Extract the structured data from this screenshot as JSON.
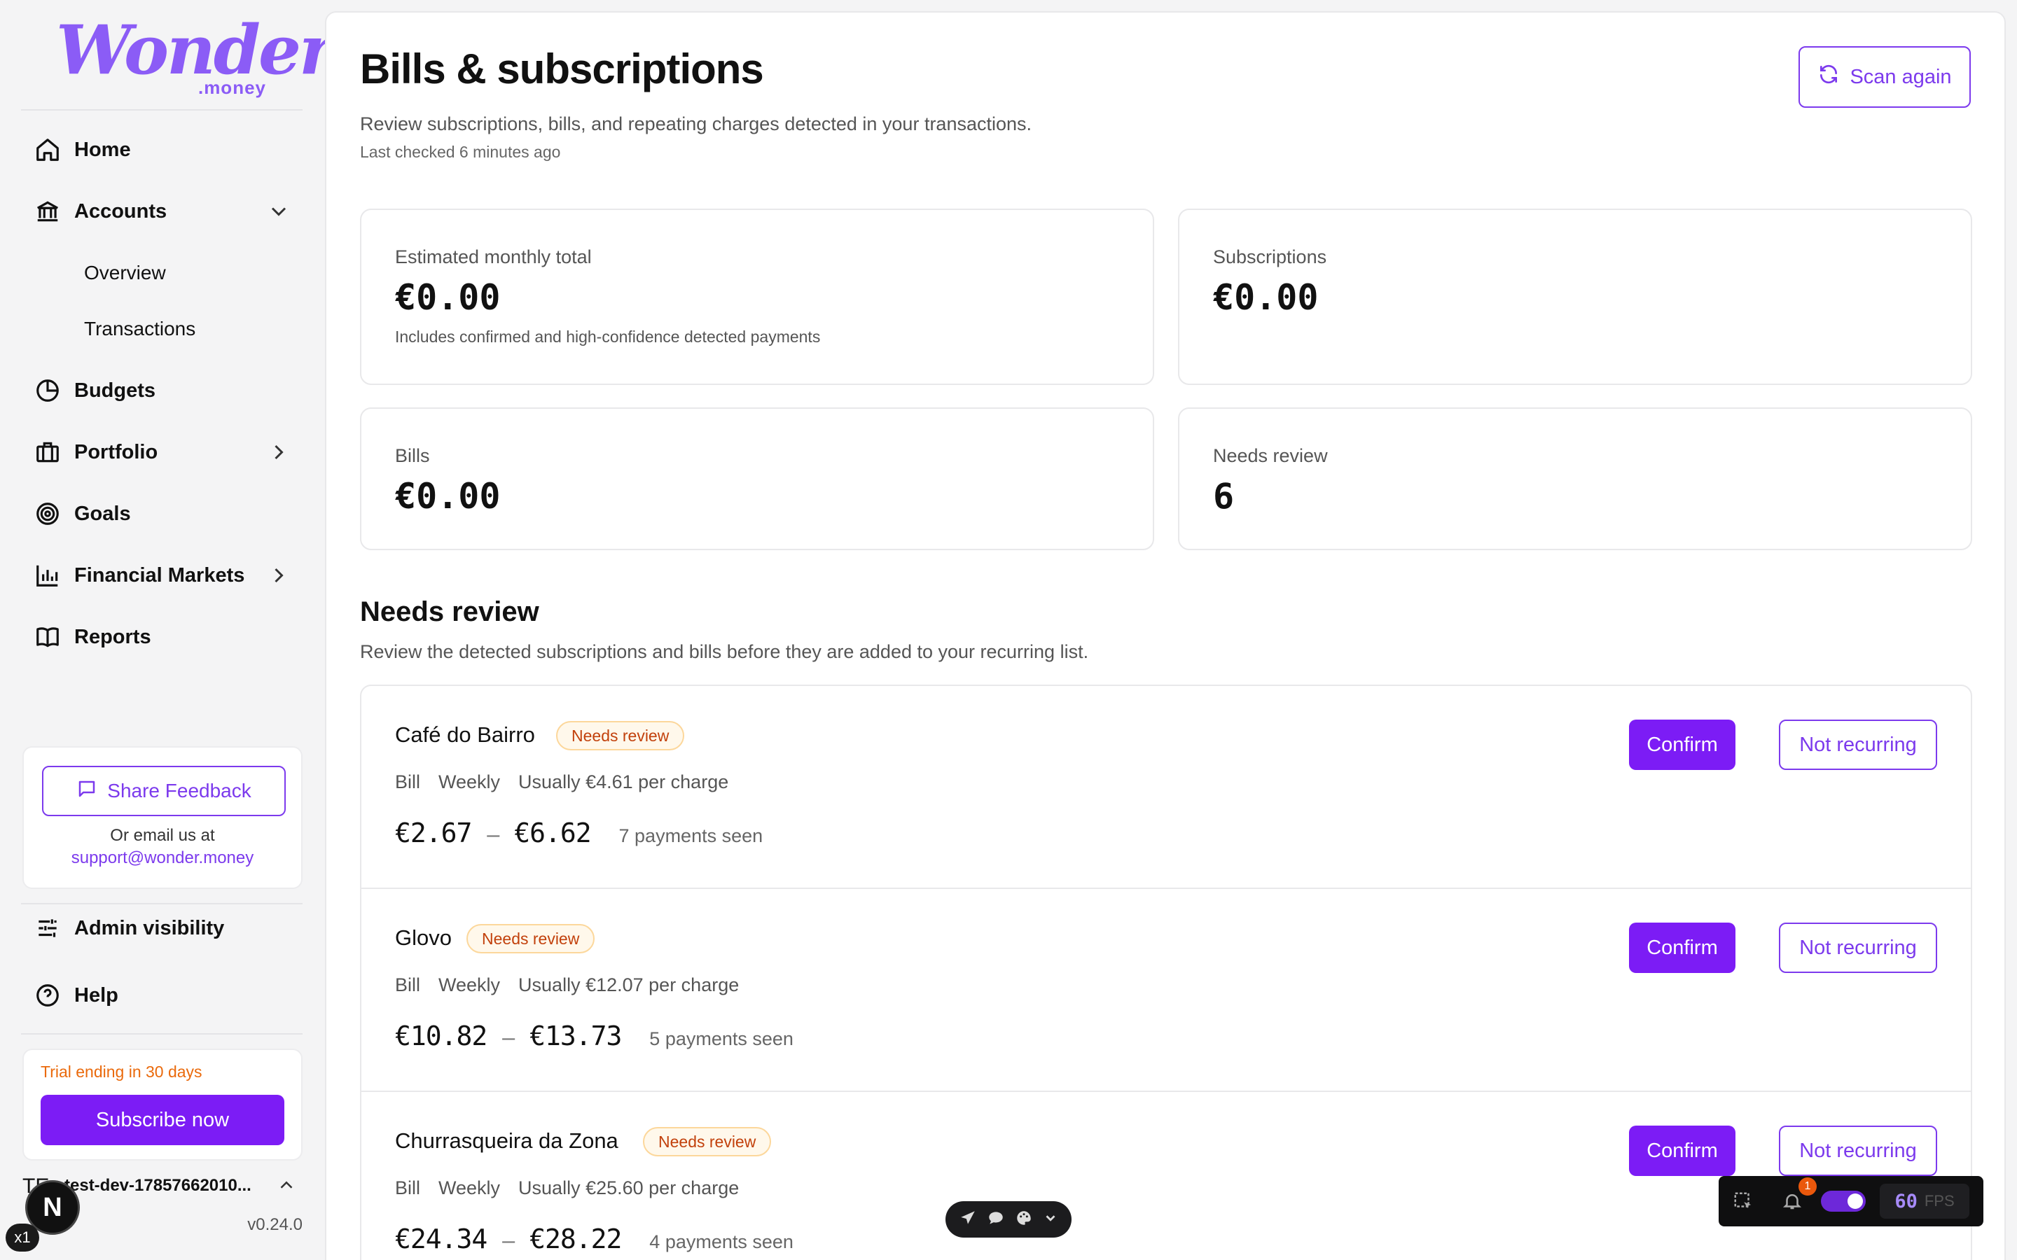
{
  "brand": {
    "name": "Wonder",
    "tld": ".money",
    "color": "#8b5cf6"
  },
  "sidebar": {
    "items": [
      {
        "label": "Home",
        "icon": "home-icon"
      },
      {
        "label": "Accounts",
        "icon": "bank-icon",
        "expanded": true
      },
      {
        "label": "Overview"
      },
      {
        "label": "Transactions"
      },
      {
        "label": "Budgets",
        "icon": "pie-chart-icon"
      },
      {
        "label": "Portfolio",
        "icon": "briefcase-icon"
      },
      {
        "label": "Goals",
        "icon": "target-icon"
      },
      {
        "label": "Financial Markets",
        "icon": "bar-chart-icon"
      },
      {
        "label": "Reports",
        "icon": "book-icon"
      }
    ],
    "feedback": {
      "button_label": "Share Feedback",
      "or_text": "Or email us at",
      "email": "support@wonder.money"
    },
    "admin_label": "Admin visibility",
    "help_label": "Help",
    "trial": {
      "text": "Trial ending in 30 days",
      "button_label": "Subscribe now"
    },
    "user": {
      "initials": "TE",
      "name": "test-dev-17857662010..."
    },
    "version": "v0.24.0"
  },
  "page": {
    "title": "Bills & subscriptions",
    "subtitle": "Review subscriptions, bills, and repeating charges detected in your transactions.",
    "last_checked": "Last checked 6 minutes ago",
    "scan_button": "Scan again"
  },
  "stats": {
    "monthly": {
      "label": "Estimated monthly total",
      "value": "€0.00",
      "note": "Includes confirmed and high-confidence detected payments"
    },
    "subscriptions": {
      "label": "Subscriptions",
      "value": "€0.00"
    },
    "bills": {
      "label": "Bills",
      "value": "€0.00"
    },
    "needs_review": {
      "label": "Needs review",
      "value": "6"
    }
  },
  "needs_review": {
    "title": "Needs review",
    "subtitle": "Review the detected subscriptions and bills before they are added to your recurring list.",
    "confirm_label": "Confirm",
    "not_recurring_label": "Not recurring",
    "items": [
      {
        "name": "Café do Bairro",
        "badge": "Needs review",
        "type": "Bill",
        "frequency": "Weekly",
        "usual": "Usually €4.61 per charge",
        "min": "€2.67",
        "sep": "–",
        "max": "€6.62",
        "seen": "7 payments seen"
      },
      {
        "name": "Glovo",
        "badge": "Needs review",
        "type": "Bill",
        "frequency": "Weekly",
        "usual": "Usually €12.07 per charge",
        "min": "€10.82",
        "sep": "–",
        "max": "€13.73",
        "seen": "5 payments seen"
      },
      {
        "name": "Churrasqueira da Zona",
        "badge": "Needs review",
        "type": "Bill",
        "frequency": "Weekly",
        "usual": "Usually €25.60 per charge",
        "min": "€24.34",
        "sep": "–",
        "max": "€28.22",
        "seen": "4 payments seen"
      }
    ]
  },
  "overlays": {
    "n_badge": "N",
    "zoom": "x1",
    "notifications": "1",
    "fps_value": "60",
    "fps_unit": "FPS"
  },
  "colors": {
    "accent": "#7c1cf5",
    "badge_text": "#c2410c",
    "trial_text": "#ea6a0c"
  }
}
